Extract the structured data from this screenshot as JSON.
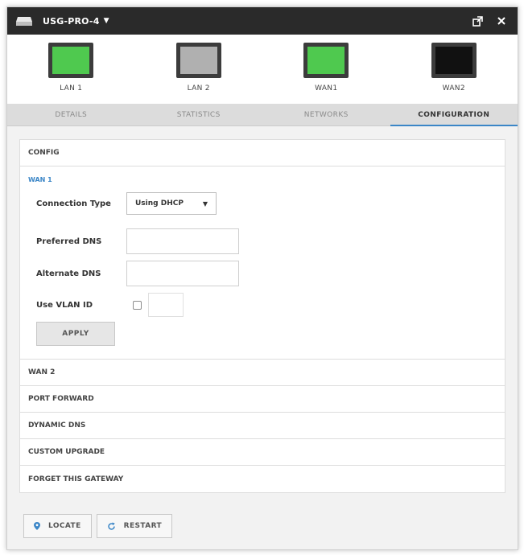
{
  "window": {
    "device_name": "USG-PRO-4"
  },
  "ports": [
    {
      "label": "LAN 1",
      "color": "#4fc94f"
    },
    {
      "label": "LAN 2",
      "color": "#b0b0b0"
    },
    {
      "label": "WAN1",
      "color": "#4fc94f"
    },
    {
      "label": "WAN2",
      "color": "#111111"
    }
  ],
  "tabs": [
    {
      "label": "DETAILS"
    },
    {
      "label": "STATISTICS"
    },
    {
      "label": "NETWORKS"
    },
    {
      "label": "CONFIGURATION"
    }
  ],
  "active_tab": "CONFIGURATION",
  "config": {
    "header": "CONFIG",
    "wan1": {
      "title": "WAN 1",
      "connection_type_label": "Connection Type",
      "connection_type_value": "Using DHCP",
      "preferred_dns_label": "Preferred DNS",
      "preferred_dns_value": "",
      "alternate_dns_label": "Alternate DNS",
      "alternate_dns_value": "",
      "vlan_label": "Use VLAN ID",
      "apply_label": "APPLY"
    },
    "sections": [
      {
        "label": "WAN 2"
      },
      {
        "label": "PORT FORWARD"
      },
      {
        "label": "DYNAMIC DNS"
      },
      {
        "label": "CUSTOM UPGRADE"
      },
      {
        "label": "FORGET THIS GATEWAY"
      }
    ]
  },
  "footer": {
    "locate_label": "LOCATE",
    "restart_label": "RESTART"
  },
  "colors": {
    "accent": "#3b86c7",
    "titlebar": "#2a2a2a"
  },
  "icons": {
    "locate": "map-pin-icon",
    "restart": "refresh-icon",
    "popout": "popout-icon",
    "close": "close-icon"
  }
}
